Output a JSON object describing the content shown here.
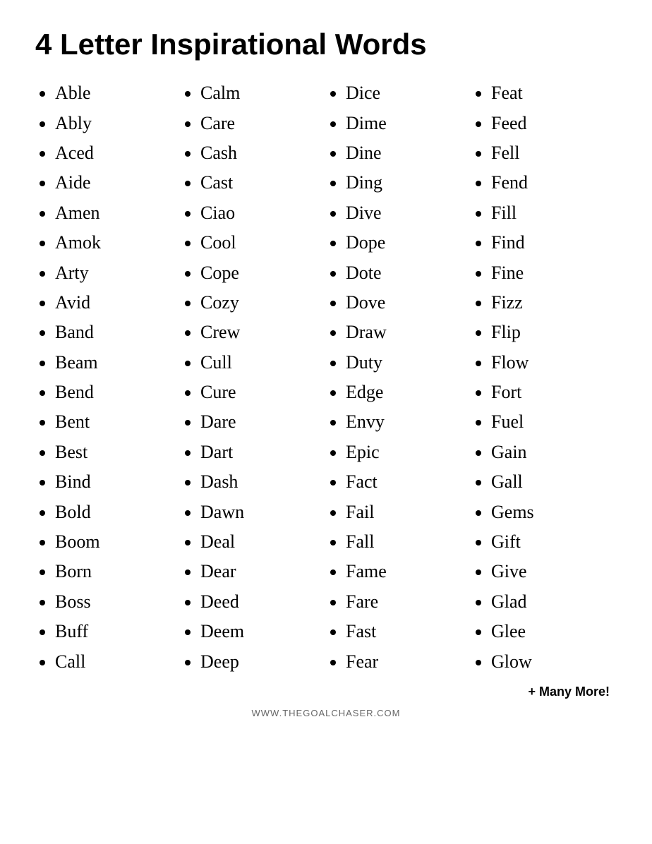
{
  "title": "4 Letter Inspirational Words",
  "columns": [
    {
      "id": "col1",
      "words": [
        "Able",
        "Ably",
        "Aced",
        "Aide",
        "Amen",
        "Amok",
        "Arty",
        "Avid",
        "Band",
        "Beam",
        "Bend",
        "Bent",
        "Best",
        "Bind",
        "Bold",
        "Boom",
        "Born",
        "Boss",
        "Buff",
        "Call"
      ]
    },
    {
      "id": "col2",
      "words": [
        "Calm",
        "Care",
        "Cash",
        "Cast",
        "Ciao",
        "Cool",
        "Cope",
        "Cozy",
        "Crew",
        "Cull",
        "Cure",
        "Dare",
        "Dart",
        "Dash",
        "Dawn",
        "Deal",
        "Dear",
        "Deed",
        "Deem",
        "Deep"
      ]
    },
    {
      "id": "col3",
      "words": [
        "Dice",
        "Dime",
        "Dine",
        "Ding",
        "Dive",
        "Dope",
        "Dote",
        "Dove",
        "Draw",
        "Duty",
        "Edge",
        "Envy",
        "Epic",
        "Fact",
        "Fail",
        "Fall",
        "Fame",
        "Fare",
        "Fast",
        "Fear"
      ]
    },
    {
      "id": "col4",
      "words": [
        "Feat",
        "Feed",
        "Fell",
        "Fend",
        "Fill",
        "Find",
        "Fine",
        "Fizz",
        "Flip",
        "Flow",
        "Fort",
        "Fuel",
        "Gain",
        "Gall",
        "Gems",
        "Gift",
        "Give",
        "Glad",
        "Glee",
        "Glow"
      ]
    }
  ],
  "more_label": "+ Many More!",
  "website": "WWW.THEGOALCHASER.COM"
}
